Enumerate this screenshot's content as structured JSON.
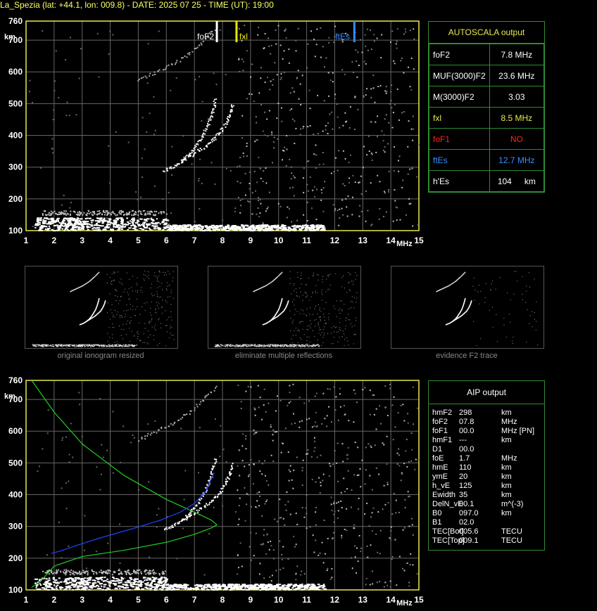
{
  "header": {
    "title": "La_Spezia (lat: +44.1, lon: 009.8) - DATE: 2025 07 25 - TIME (UT): 19:00"
  },
  "colors": {
    "axis": "#e8e850",
    "grid": "#666666",
    "echo": "#ffffff",
    "fof2": "#ffffff",
    "fxl": "#e8e800",
    "ftes": "#3a8cff",
    "profile": "#22cc22",
    "trace": "#2244ff",
    "nofof1": "#ff2020"
  },
  "axes": {
    "x_unit": "MHz",
    "y_unit": "km",
    "x_ticks": [
      "1",
      "2",
      "3",
      "4",
      "5",
      "6",
      "7",
      "8",
      "9",
      "10",
      "11",
      "12",
      "13",
      "14",
      "15"
    ],
    "y_ticks": [
      "100",
      "200",
      "300",
      "400",
      "500",
      "600",
      "700",
      "760"
    ],
    "xlim": [
      1,
      15
    ],
    "ylim": [
      100,
      760
    ]
  },
  "markers": {
    "fof2_label": "foF2",
    "fxl_label": "fxl",
    "ftes_label": "ftEs",
    "fof2": 7.8,
    "fxl": 8.5,
    "ftes": 12.7
  },
  "autoscala": {
    "title": "AUTOSCALA output",
    "rows": [
      {
        "label": "foF2",
        "value": "7.8 MHz",
        "color": "#ffffff"
      },
      {
        "label": "MUF(3000)F2",
        "value": "23.6 MHz",
        "color": "#ffffff"
      },
      {
        "label": "M(3000)F2",
        "value": "3.03",
        "color": "#ffffff"
      },
      {
        "label": "fxl",
        "value": "8.5 MHz",
        "color": "#e8e850"
      },
      {
        "label": "foF1",
        "value": "NO",
        "color": "#ff2020"
      },
      {
        "label": "ftEs",
        "value": "12.7 MHz",
        "color": "#3a8cff"
      },
      {
        "label": "h'Es",
        "value": "104",
        "unit": "km",
        "color": "#ffffff"
      }
    ]
  },
  "thumbnails": [
    {
      "label": "original ionogram resized"
    },
    {
      "label": "eliminate multiple reflections"
    },
    {
      "label": "evidence F2 trace"
    }
  ],
  "aip": {
    "title": "AIP output",
    "rows": [
      {
        "k": "hmF2",
        "v": "298",
        "u": "km"
      },
      {
        "k": "foF2",
        "v": "07.8",
        "u": "MHz"
      },
      {
        "k": "foF1",
        "v": "00.0",
        "u": "MHz   [PN]"
      },
      {
        "k": "hmF1",
        "v": "---",
        "u": "km"
      },
      {
        "k": "D1",
        "v": "00.0",
        "u": ""
      },
      {
        "k": "foE",
        "v": "1.7",
        "u": "MHz"
      },
      {
        "k": "hmE",
        "v": "110",
        "u": "km"
      },
      {
        "k": "ymE",
        "v": "20",
        "u": "km"
      },
      {
        "k": "h_vE",
        "v": "125",
        "u": "km"
      },
      {
        "k": "Ewidth",
        "v": "35",
        "u": "km"
      },
      {
        "k": "DelN_vE",
        "v": "00.1",
        "u": "m^(-3)"
      },
      {
        "k": "B0",
        "v": "097.0",
        "u": "km"
      },
      {
        "k": "B1",
        "v": "02.0",
        "u": ""
      },
      {
        "k": "TEC[Bot]",
        "v": "005.6",
        "u": "TECU"
      },
      {
        "k": "TEC[Top]",
        "v": "009.1",
        "u": "TECU"
      }
    ]
  },
  "chart_data": {
    "type": "scatter",
    "title": "",
    "xlabel": "MHz",
    "ylabel": "km",
    "xlim": [
      1,
      15
    ],
    "ylim": [
      100,
      760
    ],
    "grid": true,
    "echo_o_trace": {
      "x": [
        5.9,
        6.2,
        6.5,
        6.8,
        7.0,
        7.2,
        7.4,
        7.55,
        7.65,
        7.75
      ],
      "y": [
        292,
        302,
        318,
        340,
        362,
        390,
        420,
        455,
        485,
        520
      ]
    },
    "echo_x_trace": {
      "x": [
        6.5,
        6.9,
        7.3,
        7.6,
        7.9,
        8.1,
        8.25,
        8.35
      ],
      "y": [
        318,
        340,
        362,
        385,
        410,
        440,
        470,
        500
      ]
    },
    "echo_multihop": {
      "x": [
        5.0,
        5.6,
        6.2,
        6.8,
        7.3,
        7.8
      ],
      "y": [
        575,
        600,
        625,
        660,
        700,
        745
      ]
    },
    "es_layer": {
      "x": [
        1.3,
        2,
        3,
        4,
        5,
        6,
        7,
        8,
        9,
        10,
        11,
        11.6
      ],
      "y": [
        115,
        113,
        112,
        112,
        111,
        111,
        110,
        110,
        110,
        110,
        110,
        110
      ]
    },
    "f2_trace_fit": {
      "x": [
        1.9,
        2.2,
        2.8,
        3.5,
        4.2,
        5.0,
        5.8,
        6.5,
        7.0,
        7.4,
        7.7
      ],
      "y": [
        215,
        222,
        240,
        260,
        278,
        298,
        320,
        345,
        372,
        410,
        470
      ]
    },
    "electron_density_profile": {
      "x": [
        1.2,
        1.5,
        2.0,
        3.0,
        4.5,
        6.0,
        7.0,
        7.6,
        7.8,
        7.6,
        7.0,
        6.0,
        4.5,
        3.0,
        2.0,
        1.2
      ],
      "y": [
        108,
        125,
        175,
        205,
        225,
        250,
        275,
        295,
        305,
        320,
        345,
        385,
        460,
        560,
        660,
        760
      ]
    }
  }
}
